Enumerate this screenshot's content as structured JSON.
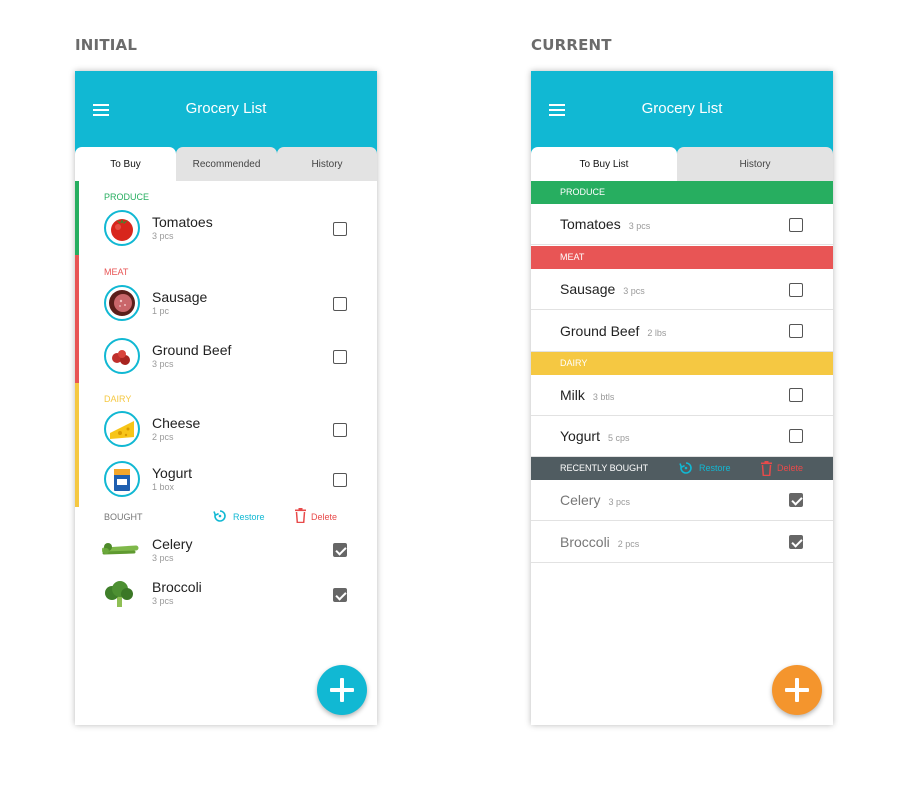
{
  "labels": {
    "initial": "INITIAL",
    "current": "CURRENT"
  },
  "colors": {
    "header": "#11b8d3",
    "produce": "#27ae60",
    "meat": "#e85555",
    "dairy": "#f5c842",
    "fab_initial": "#11b8d3",
    "fab_current": "#f4952d",
    "recently_bought": "#505c61"
  },
  "initial": {
    "title": "Grocery List",
    "tabs": [
      "To Buy",
      "Recommended",
      "History"
    ],
    "categories": {
      "produce": "PRODUCE",
      "meat": "MEAT",
      "dairy": "DAIRY"
    },
    "items": [
      {
        "name": "Tomatoes",
        "qty": "3 pcs",
        "icon": "tomato-icon"
      },
      {
        "name": "Sausage",
        "qty": "1 pc",
        "icon": "sausage-icon"
      },
      {
        "name": "Ground Beef",
        "qty": "3 pcs",
        "icon": "ground-beef-icon"
      },
      {
        "name": "Cheese",
        "qty": "2 pcs",
        "icon": "cheese-icon"
      },
      {
        "name": "Yogurt",
        "qty": "1 box",
        "icon": "yogurt-icon"
      }
    ],
    "bought_label": "BOUGHT",
    "restore": "Restore",
    "delete": "Delete",
    "bought": [
      {
        "name": "Celery",
        "qty": "3 pcs",
        "icon": "celery-icon"
      },
      {
        "name": "Broccoli",
        "qty": "3 pcs",
        "icon": "broccoli-icon"
      }
    ]
  },
  "current": {
    "title": "Grocery List",
    "tabs": [
      "To Buy List",
      "History"
    ],
    "categories": {
      "produce": "PRODUCE",
      "meat": "MEAT",
      "dairy": "DAIRY",
      "recent": "RECENTLY BOUGHT"
    },
    "items": [
      {
        "name": "Tomatoes",
        "qty": "3 pcs"
      },
      {
        "name": "Sausage",
        "qty": "3 pcs"
      },
      {
        "name": "Ground Beef",
        "qty": "2 lbs"
      },
      {
        "name": "Milk",
        "qty": "3 btls"
      },
      {
        "name": "Yogurt",
        "qty": "5 cps"
      }
    ],
    "restore": "Restore",
    "delete": "Delete",
    "bought": [
      {
        "name": "Celery",
        "qty": "3 pcs"
      },
      {
        "name": "Broccoli",
        "qty": "2 pcs"
      }
    ]
  }
}
